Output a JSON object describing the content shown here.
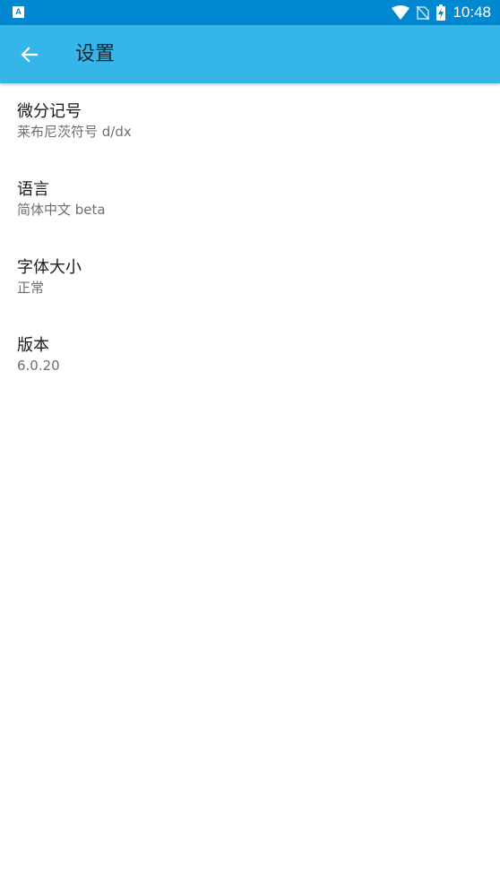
{
  "status_bar": {
    "time": "10:48",
    "notification_icon_letter": "A",
    "icons": [
      "app-notification-icon",
      "wifi-icon",
      "no-sim-icon",
      "battery-charging-icon"
    ],
    "color": "#0288d1"
  },
  "app_bar": {
    "title": "设置",
    "back_icon": "arrow-left-icon",
    "color": "#35b5e8"
  },
  "settings": {
    "items": [
      {
        "title": "微分记号",
        "value": "莱布尼茨符号 d/dx"
      },
      {
        "title": "语言",
        "value": "简体中文 beta"
      },
      {
        "title": "字体大小",
        "value": "正常"
      },
      {
        "title": "版本",
        "value": "6.0.20"
      }
    ]
  }
}
